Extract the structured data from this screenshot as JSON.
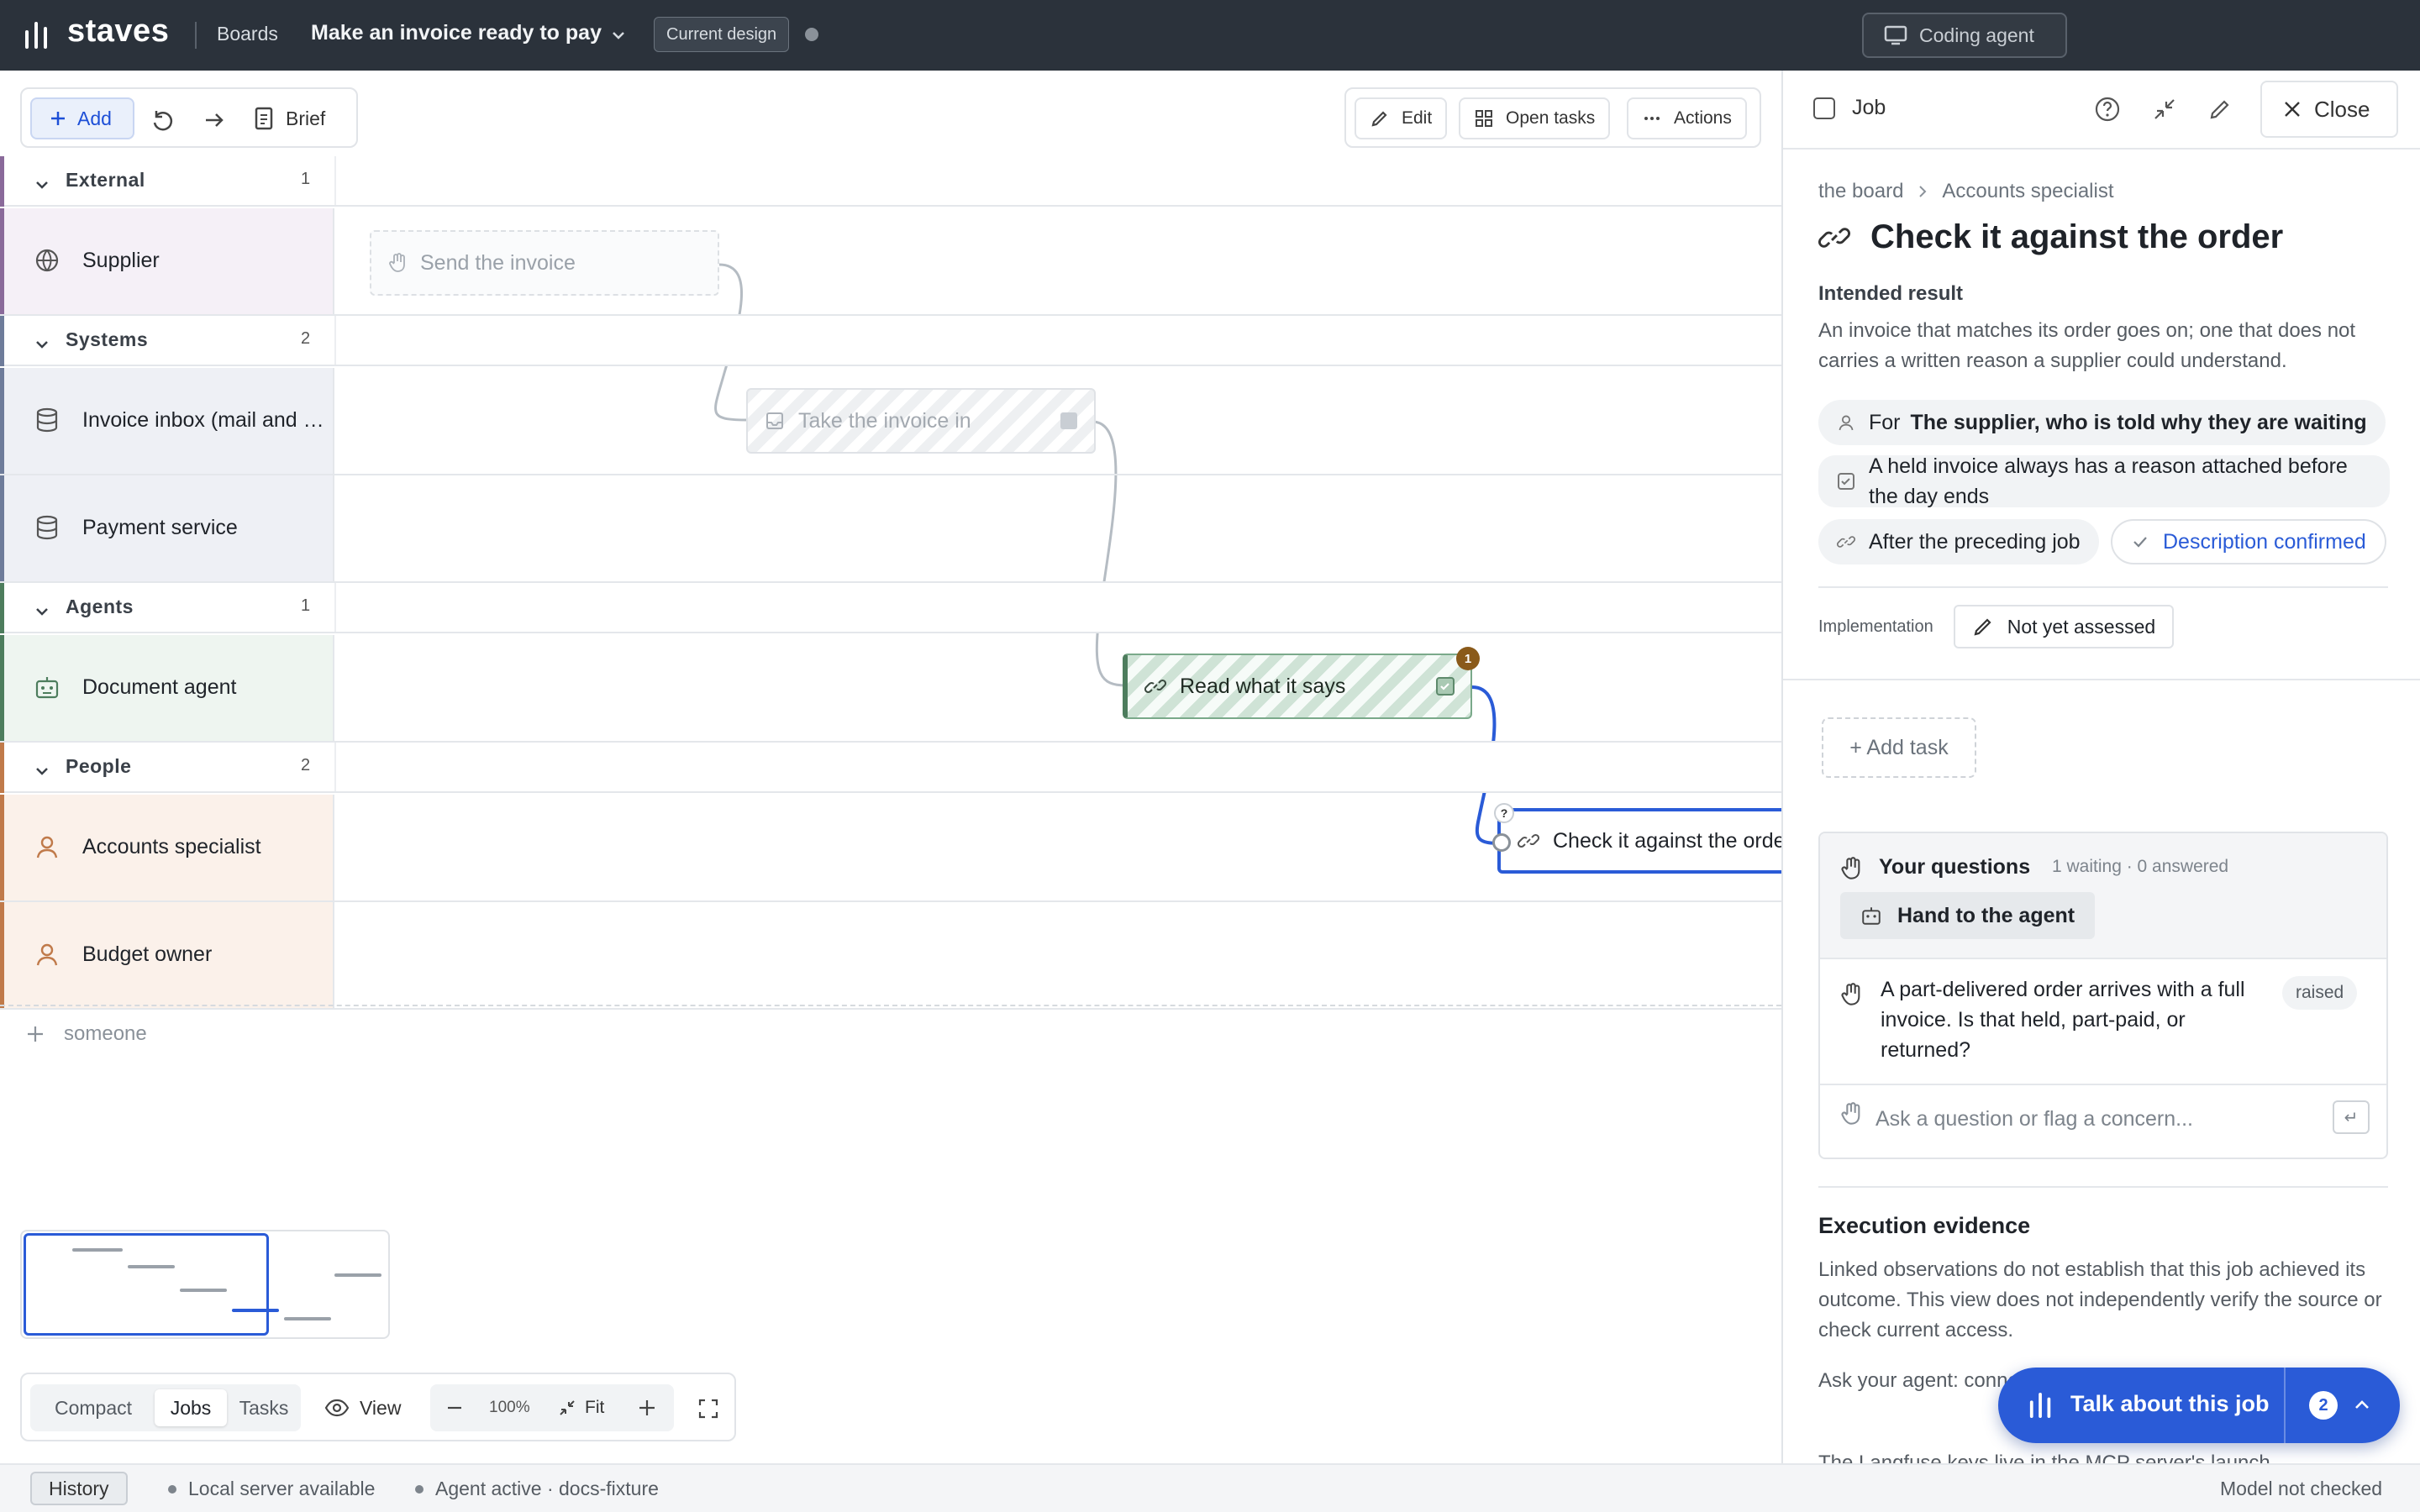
{
  "topbar": {
    "logo": "staves",
    "boards": "Boards",
    "title": "Make an invoice ready to pay",
    "badge": "Current design",
    "coding_agent": "Coding agent"
  },
  "toolbar": {
    "add": "Add",
    "brief": "Brief",
    "edit": "Edit",
    "open_tasks": "Open tasks",
    "actions": "Actions"
  },
  "lanes": {
    "external": {
      "label": "External",
      "count": "1"
    },
    "supplier": "Supplier",
    "systems": {
      "label": "Systems",
      "count": "2"
    },
    "invoice_inbox": "Invoice inbox (mail and upload)",
    "payment_service": "Payment service",
    "agents": {
      "label": "Agents",
      "count": "1"
    },
    "document_agent": "Document agent",
    "people": {
      "label": "People",
      "count": "2"
    },
    "accounts_specialist": "Accounts specialist",
    "budget_owner": "Budget owner",
    "add_someone": "someone"
  },
  "nodes": {
    "send_invoice": "Send the invoice",
    "take_invoice": "Take the invoice in",
    "read_it": "Read what it says",
    "read_badge": "1",
    "check_order": "Check it against the order",
    "check_badge": "?"
  },
  "bottom": {
    "compact": "Compact",
    "jobs": "Jobs",
    "tasks": "Tasks",
    "view": "View",
    "zoom": "100%",
    "fit": "Fit"
  },
  "status": {
    "history": "History",
    "server": "Local server available",
    "agent": "Agent active · docs-fixture",
    "model": "Model not checked"
  },
  "panel": {
    "header": "Job",
    "close": "Close",
    "crumb_board": "the board",
    "crumb_lane": "Accounts specialist",
    "title": "Check it against the order",
    "intended_label": "Intended result",
    "intended_text": "An invoice that matches its order goes on; one that does not carries a written reason a supplier could understand.",
    "for_prefix": "For",
    "for_value": "The supplier, who is told why they are waiting",
    "check_text": "A held invoice always has a reason attached before the day ends",
    "after": "After the preceding job",
    "confirmed": "Description confirmed",
    "impl_label": "Implementation",
    "impl_value": "Not yet assessed",
    "add_task": "+ Add task",
    "questions_title": "Your questions",
    "questions_meta": "1 waiting · 0 answered",
    "hand_to_agent": "Hand to the agent",
    "question_text": "A part-delivered order arrives with a full invoice. Is that held, part-paid, or returned?",
    "question_status": "raised",
    "ask_placeholder": "Ask a question or flag a concern...",
    "enter_key": "↵",
    "evidence_title": "Execution evidence",
    "evidence_text": "Linked observations do not establish that this job achieved its outcome. This view does not independently verify the source or check current access.",
    "evidence_text2": "Ask your agent: connect (staves_langfuse_connect)",
    "evidence_text3": "The Langfuse keys live in the MCP server's launch"
  },
  "talk": {
    "label": "Talk about this job",
    "count": "2"
  },
  "colors": {
    "accent": "#2a5bd7",
    "external": "#8a6a9a",
    "systems": "#6e7c9a",
    "agents": "#4d7d5d",
    "people": "#c07a4a"
  }
}
